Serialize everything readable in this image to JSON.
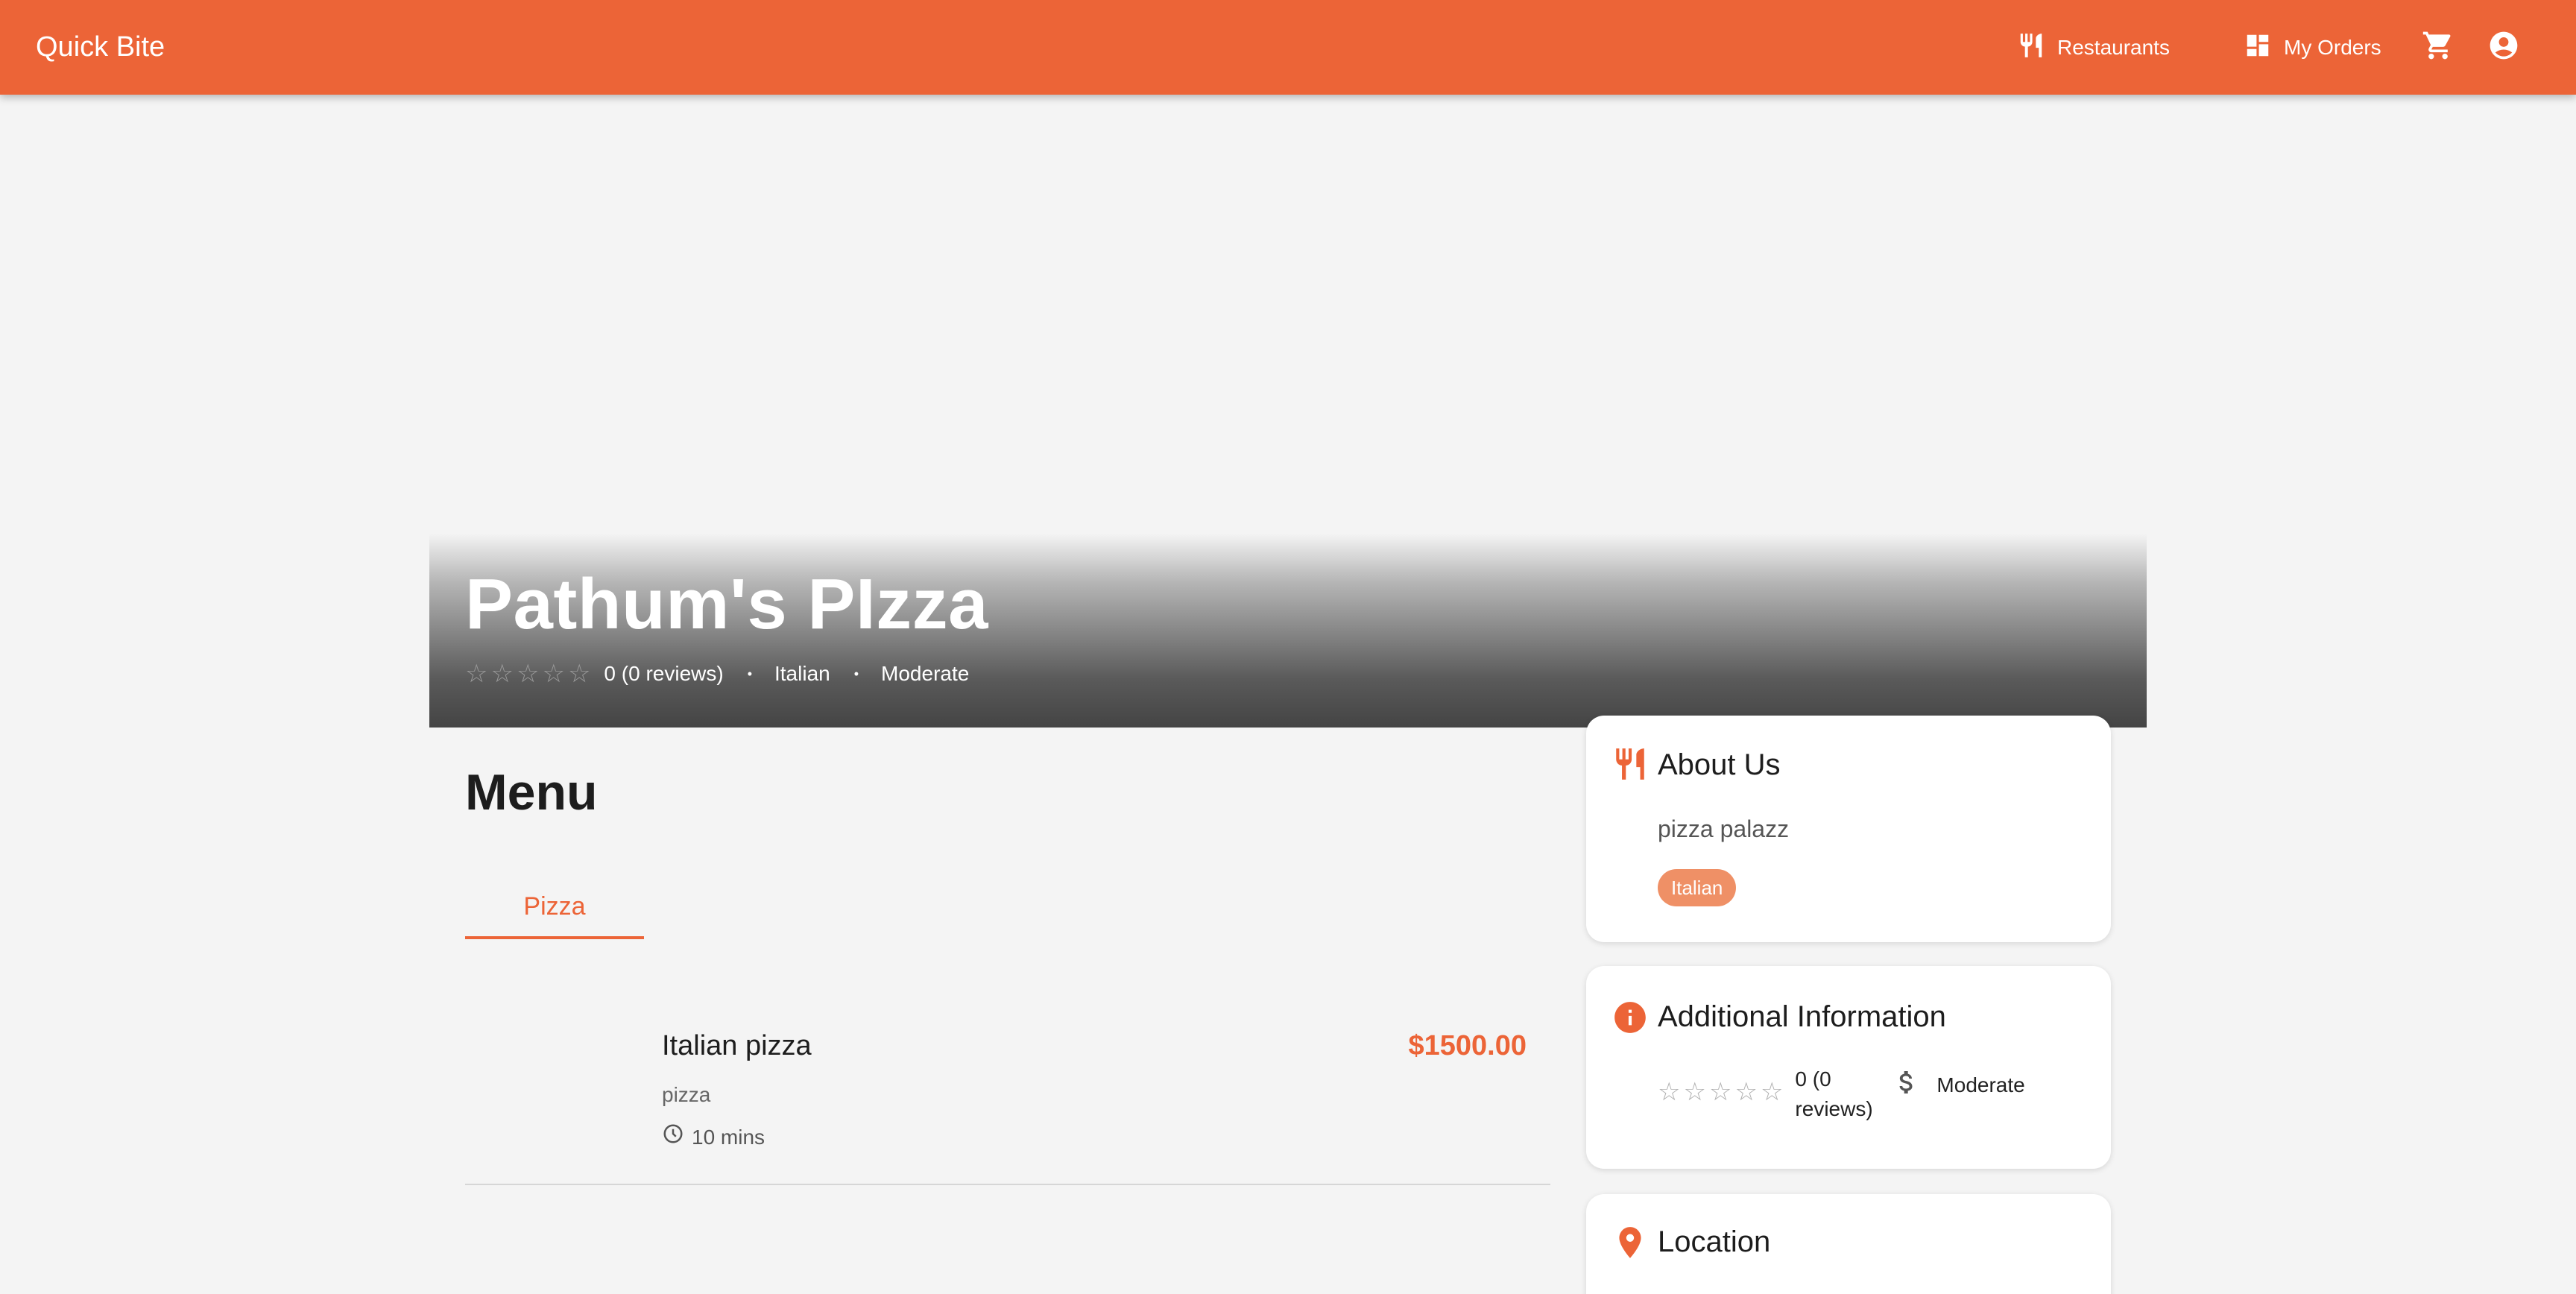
{
  "app": {
    "brand": "Quick Bite",
    "nav": {
      "restaurants": "Restaurants",
      "orders": "My Orders"
    },
    "icons": {
      "restaurants": "utensils-icon",
      "orders": "dashboard-icon",
      "cart": "cart-icon",
      "account": "account-circle-icon"
    },
    "accent_color": "#ec6437"
  },
  "restaurant": {
    "name": "Pathum's PIzza",
    "rating": 0,
    "stars": [
      "☆",
      "☆",
      "☆",
      "☆",
      "☆"
    ],
    "rating_text": "0 (0 reviews)",
    "cuisine": "Italian",
    "price_range": "Moderate",
    "separator": "•"
  },
  "menu": {
    "title": "Menu",
    "tabs": [
      {
        "label": "Pizza",
        "selected": true
      }
    ],
    "items": [
      {
        "name": "Italian pizza",
        "price": "$1500.00",
        "description": "pizza",
        "time": "10 mins"
      }
    ]
  },
  "sidebar": {
    "about": {
      "title": "About Us",
      "text": "pizza palazz",
      "tag": "Italian"
    },
    "additional": {
      "title": "Additional Information",
      "reviews": "0 (0 reviews)",
      "price": "Moderate"
    },
    "location": {
      "title": "Location"
    }
  }
}
